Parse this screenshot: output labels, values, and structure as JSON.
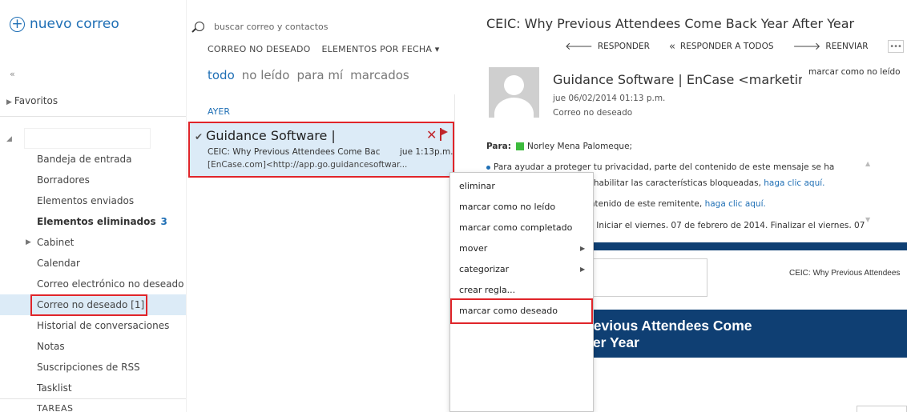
{
  "nav": {
    "new_mail": "nuevo correo",
    "collapse": "«",
    "favorites": "Favoritos",
    "folders": [
      {
        "label": "Bandeja de entrada",
        "count": ""
      },
      {
        "label": "Borradores",
        "count": ""
      },
      {
        "label": "Elementos enviados",
        "count": ""
      },
      {
        "label": "Elementos eliminados",
        "count": "3"
      },
      {
        "label": "Cabinet",
        "count": ""
      },
      {
        "label": "Calendar",
        "count": ""
      },
      {
        "label": "Correo electrónico no deseado",
        "count": ""
      },
      {
        "label": "Correo no deseado [1]",
        "count": ""
      },
      {
        "label": "Historial de conversaciones",
        "count": ""
      },
      {
        "label": "Notas",
        "count": ""
      },
      {
        "label": "Suscripciones de RSS",
        "count": ""
      },
      {
        "label": "Tasklist",
        "count": ""
      }
    ],
    "tasks_header": "TAREAS"
  },
  "list": {
    "search_placeholder": "buscar correo y contactos",
    "folder_name": "CORREO NO DESEADO",
    "sort_label": "ELEMENTOS POR FECHA ▾",
    "filters": [
      "todo",
      "no leído",
      "para mí",
      "marcados"
    ],
    "date_header": "AYER",
    "item": {
      "sender": "Guidance Software |",
      "subject": "CEIC: Why Previous Attendees Come Bac",
      "time": "jue 1:13p.m.",
      "preview": "[EnCase.com]<http://app.go.guidancesoftwar..."
    }
  },
  "reading": {
    "subject": "CEIC: Why Previous Attendees Come Back Year After Year",
    "actions": {
      "reply": "RESPONDER",
      "reply_all": "RESPONDER A TODOS",
      "forward": "REENVIAR",
      "more": "•••"
    },
    "from": "Guidance Software | EnCase <marketing@",
    "date": "jue 06/02/2014 01:13 p.m.",
    "folder": "Correo no deseado",
    "mark_unread": "marcar como no leído",
    "to_label": "Para:",
    "to_name": "Norley Mena Palomeque;",
    "notice_line1": "Para ayudar a proteger tu privacidad, parte del contenido de este mensaje se ha",
    "notice_line2_prefix": "bloqueado. Para volver a habilitar las características bloqueadas,",
    "notice_link1": "haga clic aquí.",
    "notice_line3_prefix": "Para mostrar siempre contenido de este remitente,",
    "notice_link2": "haga clic aquí.",
    "notice_line4": "Seguimiento de mensaje. Iniciar el viernes, 07 de febrero de 2014. Finalizar el viernes, 07",
    "embed_title": "CEIC: Why Previous Attendees",
    "banner_line1": "CEIC: Why Previous Attendees Come",
    "banner_line2": "Back Year After Year"
  },
  "context_menu": {
    "items": [
      {
        "label": "eliminar",
        "submenu": false
      },
      {
        "label": "marcar como no leído",
        "submenu": false
      },
      {
        "label": "marcar como completado",
        "submenu": false
      },
      {
        "label": "mover",
        "submenu": true
      },
      {
        "label": "categorizar",
        "submenu": true
      },
      {
        "label": "crear regla...",
        "submenu": false
      },
      {
        "label": "marcar como deseado",
        "submenu": false
      }
    ]
  },
  "colors": {
    "accent": "#1f6fb5",
    "selection": "#dcebf7",
    "highlight_box": "#e0252a",
    "flag": "#c0262c",
    "banner": "#0f3f73"
  }
}
